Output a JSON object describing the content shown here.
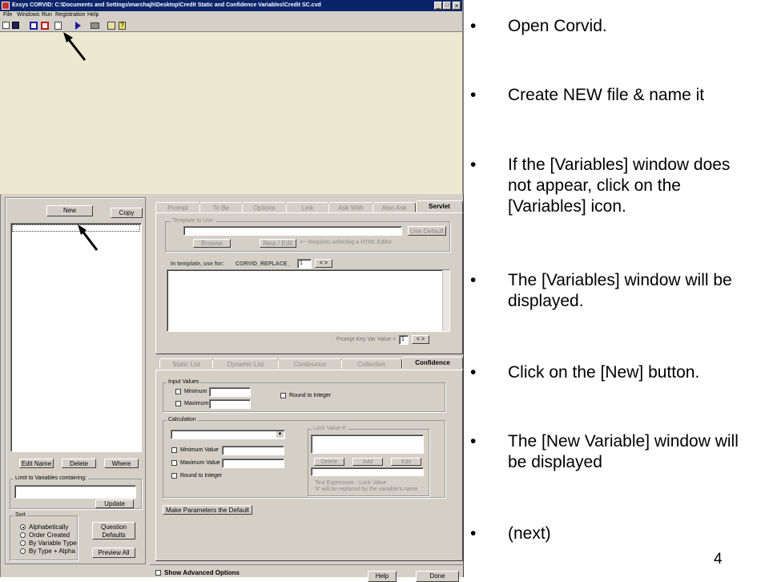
{
  "window": {
    "title": "Exsys CORVID: C:\\Documents and Settings\\marchajh\\Desktop\\Credit Static and Confidence Variables\\Credit SC.cvd",
    "menu": [
      "File",
      "Windows",
      "Run",
      "Registration",
      "Help"
    ]
  },
  "variables_window": {
    "new_label": "New",
    "copy_label": "Copy",
    "edit_name_label": "Edit Name",
    "delete_label": "Delete",
    "where_label": "Where",
    "limit_label": "Limit to Variables containing:",
    "update_label": "Update",
    "sort_label": "Sort",
    "sort_options": [
      "Alphabetically",
      "Order Created",
      "By Variable Type",
      "By Type + Alpha"
    ],
    "question_defaults_label": "Question Defaults",
    "preview_all_label": "Preview All",
    "top_tabs": [
      "Prompt",
      "To Be",
      "Options",
      "Link",
      "Ask With",
      "Also Ask",
      "Servlet"
    ],
    "template_group_label": "Template to Use:",
    "use_default_label": "Use Default",
    "browse_label": "Browse",
    "new_edit_label": "New / Edit",
    "requires_note": "<-- Requires selecting a HTML Editor",
    "in_template_label": "In template, use for:",
    "corvid_replace": "CORVID_REPLACE_",
    "replace_index": "1",
    "prompt_key_label": "Prompt Key Var Value =",
    "prompt_key_value": "1",
    "bottom_tabs": [
      "Static List",
      "Dynamic List",
      "Continuous",
      "Collection",
      "Confidence"
    ],
    "input_values_label": "Input Values",
    "minimum_label": "Minimum",
    "maximum_label": "Maximum",
    "round_to_integer_label": "Round to Integer",
    "calculation_label": "Calculation",
    "minimum_value_label": "Minimum Value",
    "maximum_value_label": "Maximum Value",
    "calc_round_label": "Round to Integer",
    "lock_value_label": "Lock Value If:",
    "lock_delete_label": "Delete",
    "lock_add_label": "Add",
    "lock_edit_label": "Edit",
    "test_expression_label": "Test Expression : Lock Value",
    "replaced_note": "'#' will be replaced by the variable's  name",
    "make_default_label": "Make Parameters the Default",
    "show_advanced_label": "Show Advanced Options",
    "help_label": "Help",
    "done_label": "Done"
  },
  "instructions": [
    "Open Corvid.",
    "Create NEW file & name it",
    "If the [Variables] window does not appear, click on the [Variables] icon.",
    "The [Variables] window will be displayed.",
    "Click on the [New] button.",
    "The [New Variable] window will be displayed",
    "(next)"
  ],
  "bullet_char": "•",
  "page_number": "4",
  "colors": {
    "title_bar": "#0a246a",
    "face": "#d4d0c8",
    "app_background": "#ece9d0"
  }
}
